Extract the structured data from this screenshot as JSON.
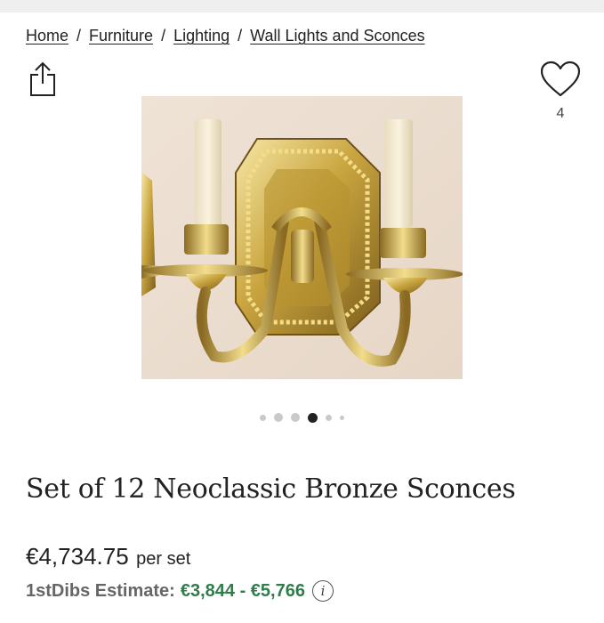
{
  "breadcrumb": {
    "items": [
      {
        "label": "Home"
      },
      {
        "label": "Furniture"
      },
      {
        "label": "Lighting"
      },
      {
        "label": "Wall Lights and Sconces"
      }
    ],
    "separator": "/"
  },
  "favorites": {
    "count": "4",
    "icon": "heart-outline-icon"
  },
  "share": {
    "icon": "share-icon"
  },
  "hero": {
    "image": "brass-two-arm-sconce-photo",
    "alt": "Set of 12 Neoclassic Bronze Sconces"
  },
  "carousel": {
    "total_dots": 6,
    "active_index": 3
  },
  "product": {
    "title": "Set of 12 Neoclassic Bronze Sconces",
    "price": "€4,734.75",
    "price_unit": "per set",
    "estimate_label": "1stDibs Estimate:",
    "estimate_range": "€3,844 - €5,766",
    "info_icon": "info-icon"
  },
  "colors": {
    "estimate_green": "#2e7d4a",
    "text": "#222222"
  }
}
